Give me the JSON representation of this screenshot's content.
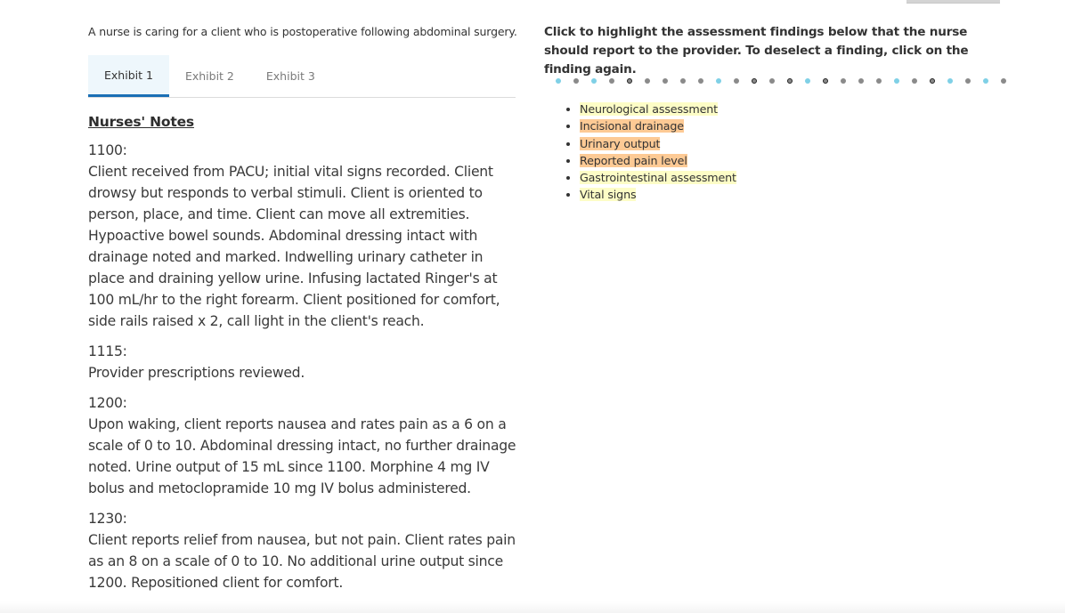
{
  "question": {
    "stem": "A nurse is caring for a client who is postoperative following abdominal surgery."
  },
  "tabs": [
    {
      "label": "Exhibit 1",
      "active": true
    },
    {
      "label": "Exhibit 2",
      "active": false
    },
    {
      "label": "Exhibit 3",
      "active": false
    }
  ],
  "notes": {
    "title": "Nurses' Notes",
    "entries": [
      {
        "time": "1100:",
        "text": "Client received from PACU; initial vital signs recorded. Client drowsy but responds to verbal stimuli. Client is oriented to person, place, and time. Client can move all extremities. Hypoactive bowel sounds. Abdominal dressing intact with drainage noted and marked. Indwelling urinary catheter in place and draining yellow urine. Infusing lactated Ringer's at 100 mL/hr to the right forearm. Client positioned for comfort, side rails raised x 2, call light in the client's reach."
      },
      {
        "time": "1115:",
        "text": "Provider prescriptions reviewed."
      },
      {
        "time": "1200:",
        "text": "Upon waking, client reports nausea and rates pain as a 6 on a scale of 0 to 10. Abdominal dressing intact, no further drainage noted. Urine output of 15 mL since 1100. Morphine 4 mg IV bolus and metoclopramide 10 mg IV bolus administered."
      },
      {
        "time": "1230:",
        "text": "Client reports relief from nausea, but not pain. Client rates pain as an 8 on a scale of 0 to 10. No additional urine output since 1200. Repositioned client for comfort."
      }
    ]
  },
  "instructions": "Click to highlight the assessment findings below that the nurse should report to the provider. To deselect a finding, click on the finding again.",
  "progress_dots": [
    "blue",
    "gray",
    "blue",
    "gray",
    "ring",
    "gray",
    "gray",
    "gray",
    "gray",
    "blue",
    "gray",
    "ring",
    "gray",
    "ring",
    "blue",
    "ring",
    "gray",
    "gray",
    "gray",
    "blue",
    "gray",
    "ring",
    "blue",
    "gray",
    "blue",
    "gray"
  ],
  "findings": [
    {
      "label": "Neurological assessment",
      "highlight": "yellow"
    },
    {
      "label": "Incisional drainage",
      "highlight": "orange"
    },
    {
      "label": "Urinary output",
      "highlight": "orange"
    },
    {
      "label": "Reported pain level",
      "highlight": "orange"
    },
    {
      "label": "Gastrointestinal assessment",
      "highlight": "yellow"
    },
    {
      "label": "Vital signs",
      "highlight": "yellow"
    }
  ],
  "colors": {
    "highlight_yellow": "#fdfdc6",
    "highlight_orange": "#fdca95",
    "tab_active_bg": "#eef7fc",
    "tab_active_border": "#1a6fb5",
    "dot_blue": "#7fd0e6",
    "dot_gray": "#8a8a8a"
  }
}
